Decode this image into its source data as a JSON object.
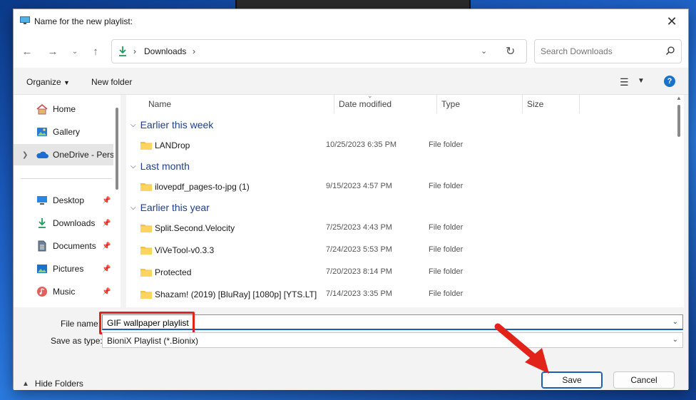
{
  "window": {
    "title": "Name for the new playlist:"
  },
  "nav": {
    "address_location": "Downloads",
    "search_placeholder": "Search Downloads"
  },
  "toolbar": {
    "organize_label": "Organize",
    "new_folder_label": "New folder"
  },
  "sidebar": {
    "items": [
      {
        "label": "Home"
      },
      {
        "label": "Gallery"
      },
      {
        "label": "OneDrive - Personal"
      },
      {
        "label": "Desktop"
      },
      {
        "label": "Downloads"
      },
      {
        "label": "Documents"
      },
      {
        "label": "Pictures"
      },
      {
        "label": "Music"
      }
    ]
  },
  "files": {
    "columns": [
      "Name",
      "Date modified",
      "Type",
      "Size"
    ],
    "groups": [
      {
        "label": "Earlier this week",
        "rows": [
          {
            "name": "LANDrop",
            "date": "10/25/2023 6:35 PM",
            "type": "File folder"
          }
        ]
      },
      {
        "label": "Last month",
        "rows": [
          {
            "name": "ilovepdf_pages-to-jpg (1)",
            "date": "9/15/2023 4:57 PM",
            "type": "File folder"
          }
        ]
      },
      {
        "label": "Earlier this year",
        "rows": [
          {
            "name": "Split.Second.Velocity",
            "date": "7/25/2023 4:43 PM",
            "type": "File folder"
          },
          {
            "name": "ViVeTool-v0.3.3",
            "date": "7/24/2023 5:53 PM",
            "type": "File folder"
          },
          {
            "name": "Protected",
            "date": "7/20/2023 8:14 PM",
            "type": "File folder"
          },
          {
            "name": "Shazam! (2019) [BluRay] [1080p] [YTS.LT]",
            "date": "7/14/2023 3:35 PM",
            "type": "File folder"
          }
        ]
      }
    ]
  },
  "form": {
    "file_name_label": "File name:",
    "file_name_value": "GIF wallpaper playlist",
    "save_type_label": "Save as type:",
    "save_type_value": "BioniX Playlist (*.Bionix)"
  },
  "footer": {
    "hide_folders_label": "Hide Folders",
    "save_label": "Save",
    "cancel_label": "Cancel"
  },
  "colors": {
    "accent": "#1a5fb4",
    "highlight": "#e2231a",
    "folder": "#f4c242",
    "group_header": "#1f3f8c"
  }
}
